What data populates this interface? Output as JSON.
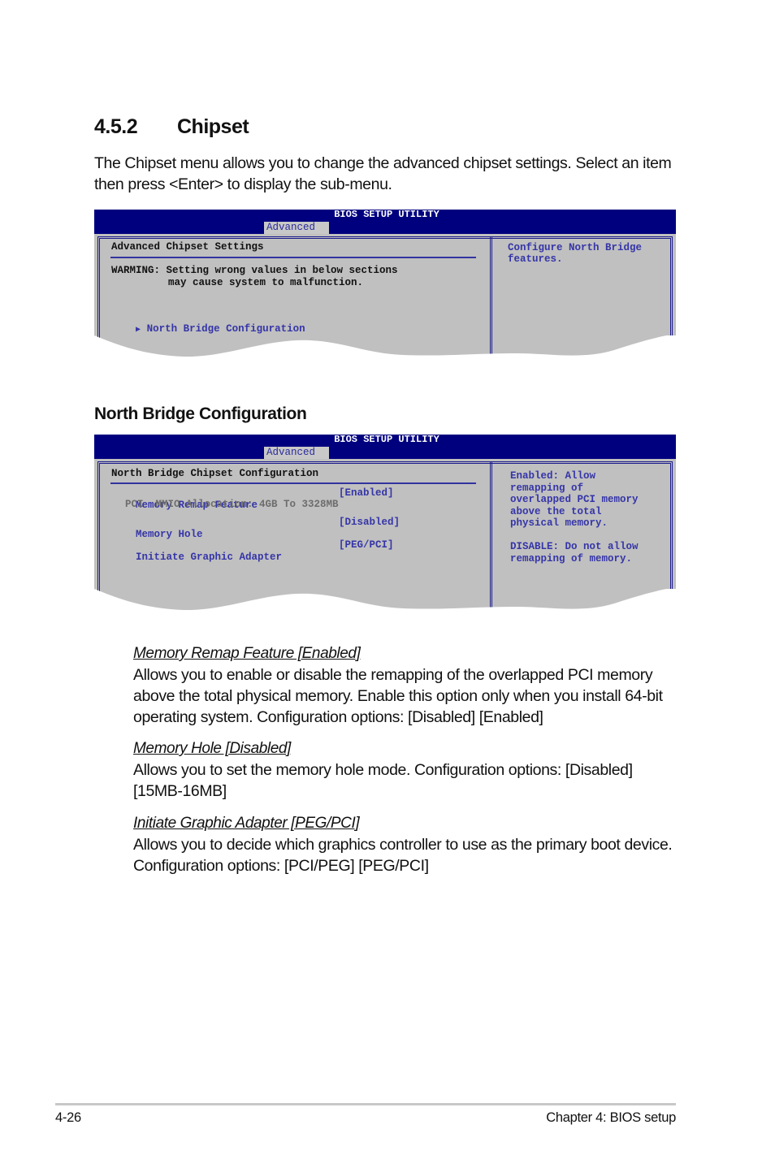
{
  "section": {
    "number": "4.5.2",
    "title": "Chipset",
    "intro": "The Chipset menu allows you to change the advanced chipset settings. Select an item then press <Enter> to display the sub-menu."
  },
  "bios1": {
    "title": "BIOS SETUP UTILITY",
    "tab": "Advanced",
    "panel_title": "Advanced Chipset Settings",
    "warning_line1": "WARMING: Setting wrong values in below sections",
    "warning_line2": "may cause system to malfunction.",
    "menu_item": "North Bridge Configuration",
    "help_line1": "Configure North Bridge",
    "help_line2": "features."
  },
  "subsection": {
    "title": "North Bridge Configuration"
  },
  "bios2": {
    "title": "BIOS SETUP UTILITY",
    "tab": "Advanced",
    "panel_title": "North Bridge Chipset Configuration",
    "items": [
      {
        "label": "Memory Remap Feature",
        "value": "[Enabled]"
      },
      {
        "label": "Memory Hole",
        "value": "[Disabled]"
      },
      {
        "label": "Initiate Graphic Adapter",
        "value": "[PEG/PCI]"
      }
    ],
    "info_line": "PCI  MMIO Allocation: 4GB To 3328MB",
    "help": [
      "Enabled: Allow",
      "remapping of",
      "overlapped PCI memory",
      "above the total",
      "physical memory.",
      "",
      "DISABLE: Do not allow",
      "remapping of memory."
    ]
  },
  "descriptions": [
    {
      "heading": "Memory Remap Feature [Enabled]",
      "body": "Allows you to enable or disable the remapping of the overlapped PCI memory above the total physical memory. Enable this option only when you install 64-bit operating system. Configuration options: [Disabled] [Enabled]"
    },
    {
      "heading": "Memory Hole [Disabled]",
      "body": "Allows you to set the memory hole mode. Configuration options: [Disabled] [15MB-16MB]"
    },
    {
      "heading": "Initiate Graphic Adapter [PEG/PCI]",
      "body": "Allows you to decide which graphics controller to use as the primary boot device. Configuration options: [PCI/PEG] [PEG/PCI]"
    }
  ],
  "footer": {
    "page": "4-26",
    "chapter": "Chapter 4: BIOS setup"
  }
}
